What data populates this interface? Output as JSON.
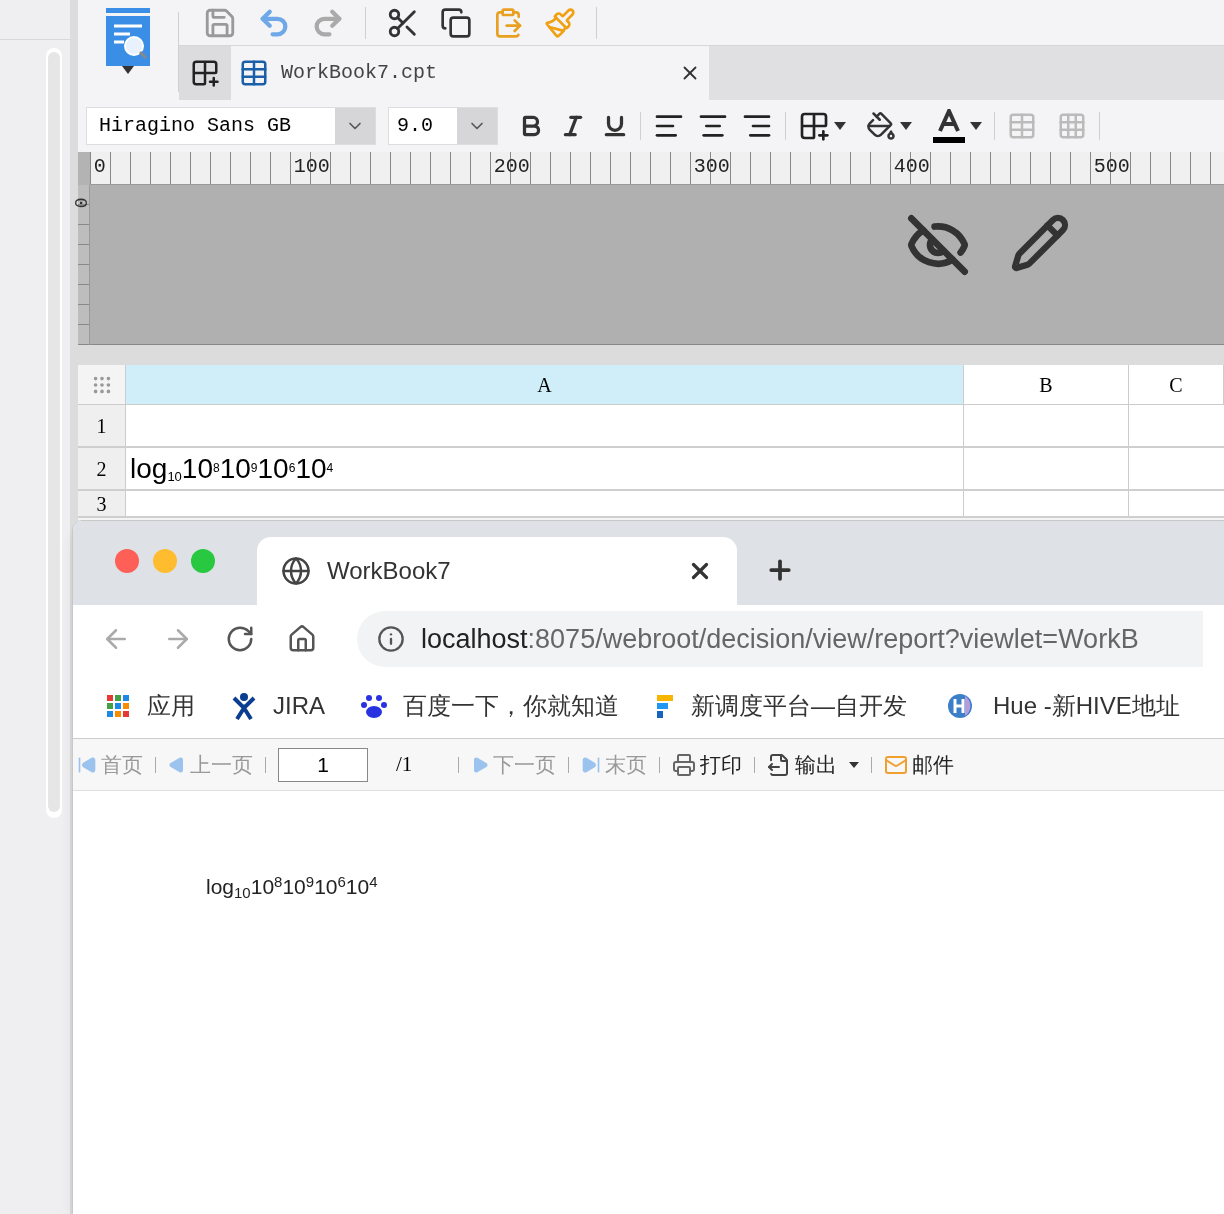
{
  "designer": {
    "file_tab": {
      "label": "WorkBook7.cpt",
      "selected": true
    },
    "font": {
      "family": "Hiragino Sans GB",
      "size": "9.0"
    },
    "format": {
      "bold": false,
      "italic": false,
      "underline": false
    },
    "ruler": {
      "ticks": [
        "0",
        "100",
        "200",
        "300",
        "400",
        "500"
      ],
      "vertical_tick": "0"
    },
    "grid": {
      "columns": [
        {
          "label": "A",
          "selected": true
        },
        {
          "label": "B",
          "selected": false
        },
        {
          "label": "C",
          "selected": false
        }
      ],
      "rows": [
        {
          "number": "1"
        },
        {
          "number": "2",
          "cell_a": "log$_{10}$10$^{8}$10$^{9}$10$^{6}$10$^{4}$"
        },
        {
          "number": "3"
        }
      ]
    }
  },
  "browser": {
    "tab": {
      "title": "WorkBook7"
    },
    "address": {
      "host": "localhost",
      "path": ":8075/webroot/decision/view/report?viewlet=WorkB"
    },
    "bookmarks": [
      {
        "label": "应用",
        "kind": "apps"
      },
      {
        "label": "JIRA",
        "kind": "jira"
      },
      {
        "label": "百度一下，你就知道",
        "kind": "paw"
      },
      {
        "label": "新调度平台—自开发",
        "kind": "flag"
      },
      {
        "label": "Hue -新HIVE地址",
        "kind": "hue"
      }
    ],
    "report_toolbar": {
      "items": [
        {
          "label": "首页",
          "kind": "first",
          "disabled": true
        },
        {
          "label": "上一页",
          "kind": "prev",
          "disabled": true
        },
        {
          "kind": "page",
          "value": "1",
          "total": "/1"
        },
        {
          "label": "下一页",
          "kind": "next",
          "disabled": true
        },
        {
          "label": "末页",
          "kind": "last",
          "disabled": true
        },
        {
          "label": "打印",
          "kind": "print",
          "disabled": false
        },
        {
          "label": "输出",
          "kind": "export",
          "disabled": false
        },
        {
          "label": "邮件",
          "kind": "mail",
          "disabled": false
        }
      ]
    },
    "report_text": "log$_{10}$10$^{8}$10$^{9}$10$^{6}$10$^{4}$"
  }
}
